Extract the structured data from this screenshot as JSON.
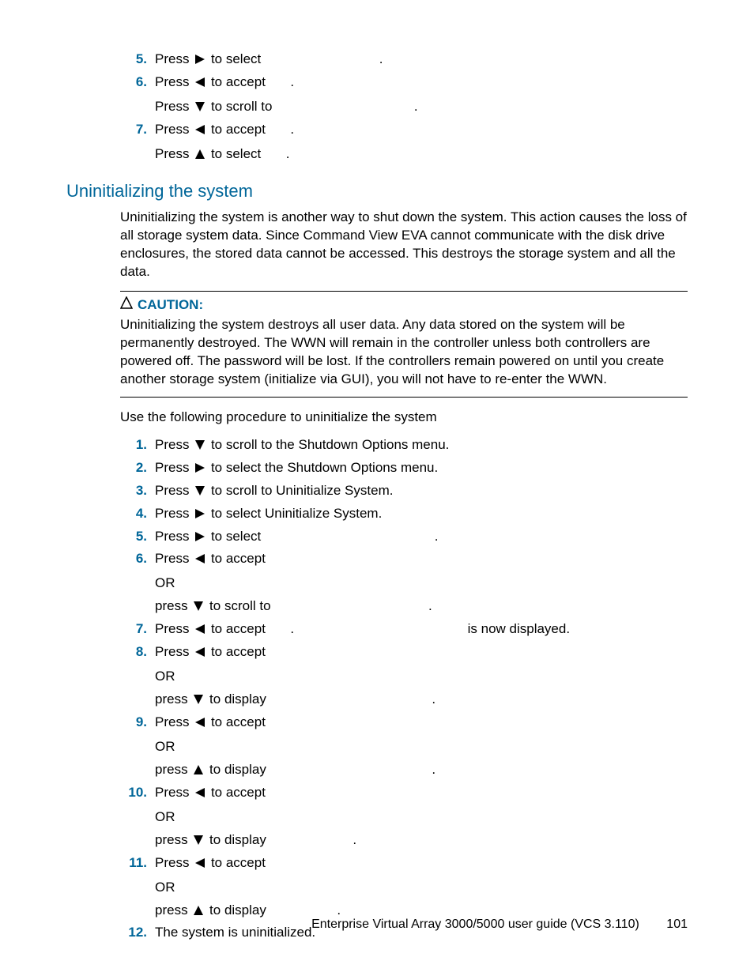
{
  "topList": {
    "i5": {
      "pre": "Press",
      "after": "to select",
      "tail": "."
    },
    "i6": {
      "pre": "Press",
      "afterA": "to accept",
      "tailA": ".",
      "preB": "Press",
      "afterB": "to scroll to",
      "tailB": "."
    },
    "i7": {
      "pre": "Press",
      "afterA": "to accept",
      "tailA": ".",
      "preB": "Press",
      "afterB": "to select",
      "tailB": "."
    }
  },
  "sectionTitle": "Uninitializing the system",
  "introPara": "Uninitializing the system is another way to shut down the system. This action causes the loss of all storage system data. Since Command View EVA cannot communicate with the disk drive enclosures, the stored data cannot be accessed. This destroys the storage system and all the data.",
  "cautionLabel": "CAUTION:",
  "cautionText": "Uninitializing the system destroys all user data. Any data stored on the system will be permanently destroyed. The WWN will remain in the controller unless both controllers are powered off. The password will be lost. If the controllers remain powered on until you create another storage system (initialize via GUI), you will not have to re-enter the WWN.",
  "procedureIntro": "Use the following procedure to uninitialize the system",
  "steps": {
    "s1": {
      "pre": "Press",
      "after": "to scroll to the Shutdown Options menu."
    },
    "s2": {
      "pre": "Press",
      "after": "to select the Shutdown Options menu."
    },
    "s3": {
      "pre": "Press",
      "after": "to scroll to Uninitialize System."
    },
    "s4": {
      "pre": "Press",
      "after": "to select Uninitialize System."
    },
    "s5": {
      "pre": "Press",
      "after": "to select",
      "tail": "."
    },
    "s6": {
      "pre": "Press",
      "after": "to accept",
      "or": "OR",
      "preB": "press",
      "afterB": "to scroll to",
      "tailB": "."
    },
    "s7": {
      "pre": "Press",
      "after": "to accept",
      "mid": ".",
      "tail": "is now displayed."
    },
    "s8": {
      "pre": "Press",
      "after": "to accept",
      "or": "OR",
      "preB": "press",
      "afterB": "to display",
      "tailB": "."
    },
    "s9": {
      "pre": "Press",
      "after": "to accept",
      "or": "OR",
      "preB": "press",
      "afterB": "to display",
      "tailB": "."
    },
    "s10": {
      "pre": "Press",
      "after": "to accept",
      "or": "OR",
      "preB": "press",
      "afterB": "to display",
      "tailB": "."
    },
    "s11": {
      "pre": "Press",
      "after": "to accept",
      "or": "OR",
      "preB": "press",
      "afterB": "to display",
      "tailB": "."
    },
    "s12": {
      "text": "The system is uninitialized."
    }
  },
  "numbers": {
    "n5": "5.",
    "n6": "6.",
    "n7": "7.",
    "m1": "1.",
    "m2": "2.",
    "m3": "3.",
    "m4": "4.",
    "m5": "5.",
    "m6": "6.",
    "m7": "7.",
    "m8": "8.",
    "m9": "9.",
    "m10": "10.",
    "m11": "11.",
    "m12": "12."
  },
  "footer": {
    "title": "Enterprise Virtual Array 3000/5000 user guide (VCS 3.110)",
    "page": "101"
  }
}
